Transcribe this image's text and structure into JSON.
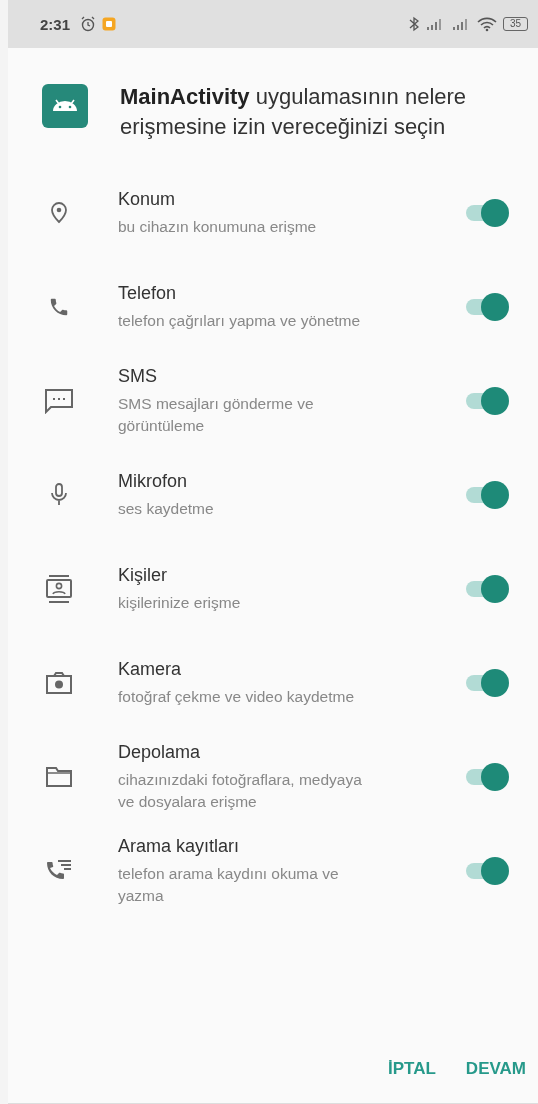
{
  "status_bar": {
    "time": "2:31",
    "battery": "35"
  },
  "dialog": {
    "title": "**MainActivity** uygulamasının nelere erişmesine izin vereceğinizi seçin"
  },
  "permissions": [
    {
      "kind": "location",
      "title": "Konum",
      "description": "bu cihazın konumuna erişme",
      "on": true
    },
    {
      "kind": "phone",
      "title": "Telefon",
      "description": "telefon çağrıları yapma ve yönetme",
      "on": true
    },
    {
      "kind": "sms",
      "title": "SMS",
      "description": "SMS mesajları gönderme ve görüntüleme",
      "on": true
    },
    {
      "kind": "microphone",
      "title": "Mikrofon",
      "description": "ses kaydetme",
      "on": true
    },
    {
      "kind": "contacts",
      "title": "Kişiler",
      "description": "kişilerinize erişme",
      "on": true
    },
    {
      "kind": "camera",
      "title": "Kamera",
      "description": "fotoğraf çekme ve video kaydetme",
      "on": true
    },
    {
      "kind": "storage",
      "title": "Depolama",
      "description": "cihazınızdaki fotoğraflara, medyaya ve dosyalara erişme",
      "on": true
    },
    {
      "kind": "call_log",
      "title": "Arama kayıtları",
      "description": "telefon arama kaydını okuma ve yazma",
      "on": true
    }
  ],
  "buttons": [
    "İPTAL",
    "DEVAM"
  ]
}
